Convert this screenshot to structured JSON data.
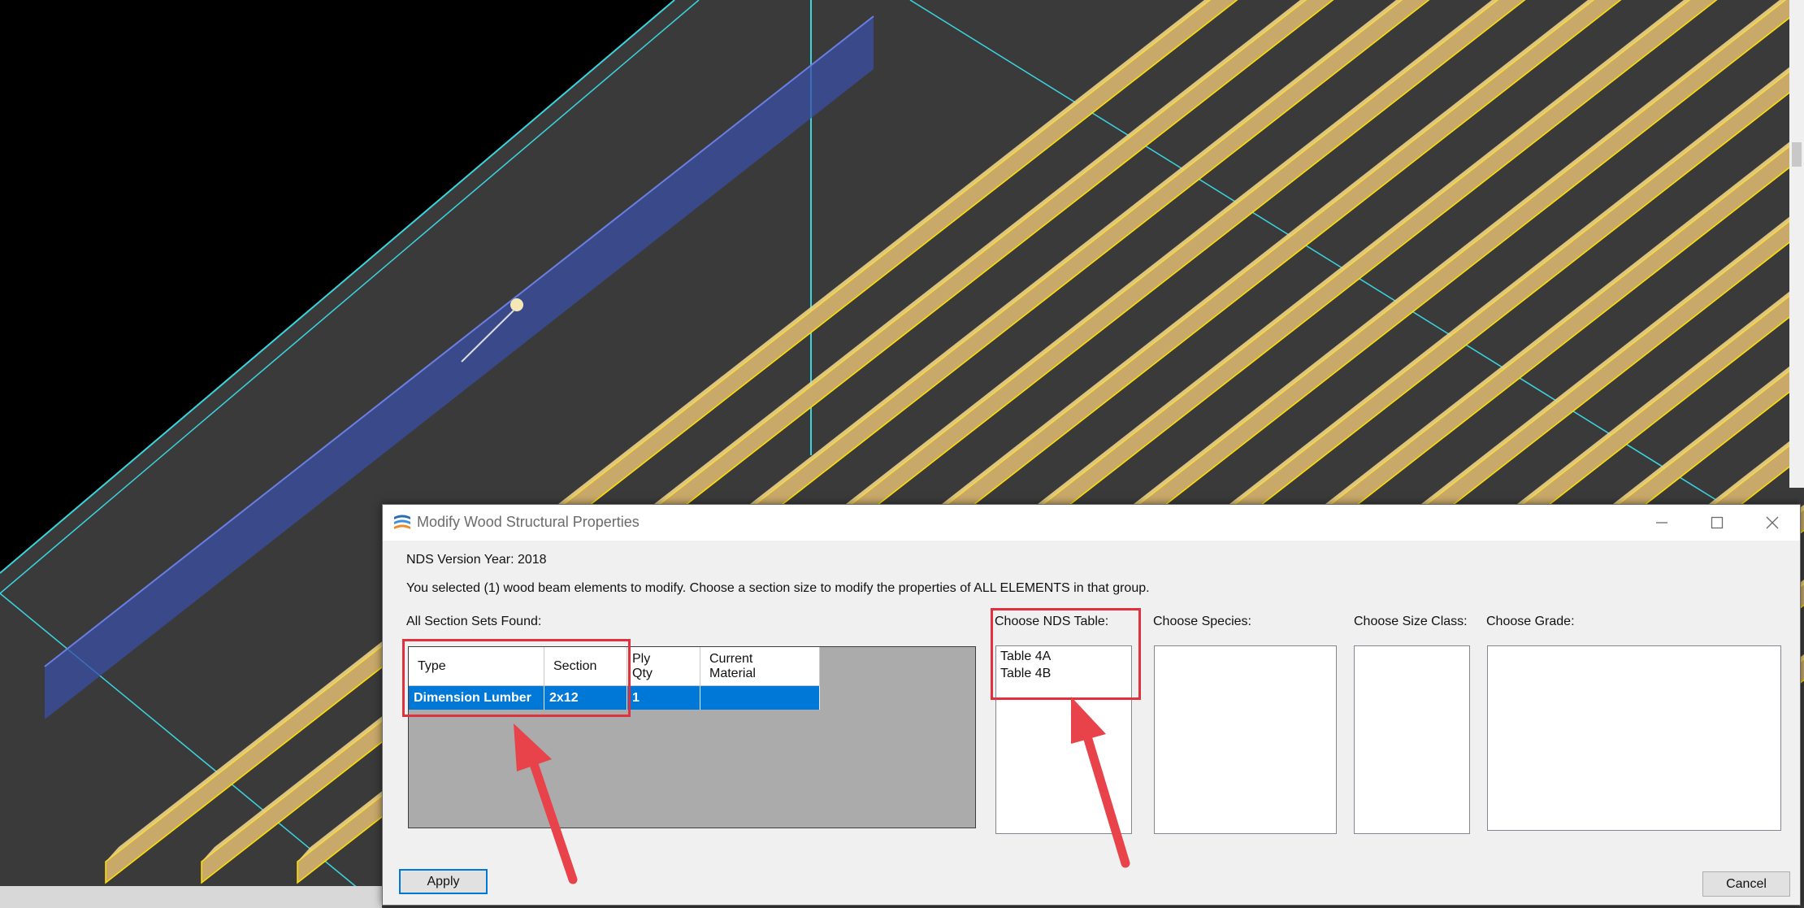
{
  "window": {
    "title": "Modify Wood Structural Properties",
    "icon": "app-logo-icon",
    "controls": [
      "minimize-icon",
      "maximize-icon",
      "close-icon"
    ]
  },
  "nds_version_label": "NDS Version Year: 2018",
  "instruction": "You selected (1) wood beam elements to modify.  Choose a section size to modify the properties of ALL ELEMENTS in that group.",
  "section_sets": {
    "label": "All Section Sets Found:",
    "columns": {
      "type": "Type",
      "section": "Section",
      "ply_qty_1": "Ply",
      "ply_qty_2": "Qty",
      "material_1": "Current",
      "material_2": "Material"
    },
    "rows": [
      {
        "type": "Dimension Lumber",
        "section": "2x12",
        "ply_qty": "1",
        "material": ""
      }
    ]
  },
  "nds_table": {
    "label": "Choose NDS Table:",
    "options": [
      "Table 4A",
      "Table 4B"
    ]
  },
  "species": {
    "label": "Choose Species:",
    "options": []
  },
  "size_class": {
    "label": "Choose Size Class:",
    "options": []
  },
  "grade": {
    "label": "Choose Grade:",
    "options": []
  },
  "buttons": {
    "apply": "Apply",
    "cancel": "Cancel"
  },
  "colors": {
    "selection": "#0078d7",
    "annotation": "#e0323e",
    "lumber": "#c9a96a",
    "edge": "#ffe100",
    "guide": "#3ad6e0"
  }
}
